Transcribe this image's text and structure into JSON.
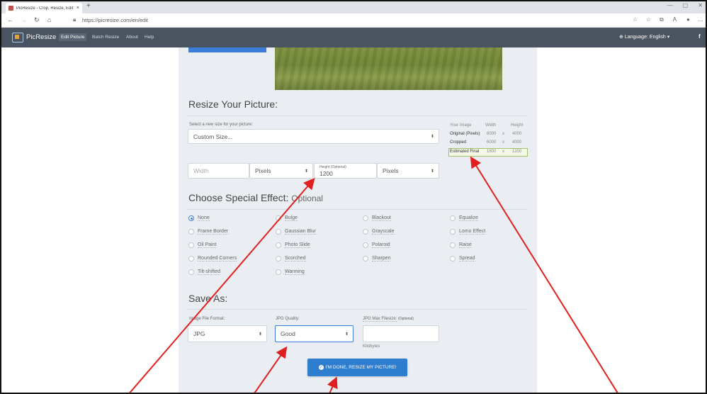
{
  "browser": {
    "tab_title": "PicResize - Crop, Resize, Edit ima",
    "tab_close": "×",
    "new_tab": "+",
    "url": "https://picresize.com/en/edit",
    "window_controls": [
      "—",
      "▢",
      "✕"
    ]
  },
  "sitenav": {
    "brand": "PicResize",
    "links": [
      "Edit Picture",
      "Batch Resize",
      "About",
      "Help"
    ],
    "language": "Language: English",
    "facebook": "f"
  },
  "resize": {
    "title": "Resize Your Picture:",
    "select_label": "Select a new size for your picture:",
    "select_value": "Custom Size...",
    "width_placeholder": "Width",
    "width_unit": "Pixels",
    "height_label": "Height (Optional)",
    "height_value": "1200",
    "height_unit": "Pixels",
    "table": {
      "headers": [
        "Your Image",
        "Width",
        "Height"
      ],
      "rows": [
        {
          "name": "Original (Pixels)",
          "width": "6000",
          "x": "x",
          "height": "4000"
        },
        {
          "name": "Cropped",
          "width": "6000",
          "x": "x",
          "height": "4000"
        },
        {
          "name": "Estimated Final",
          "width": "1800",
          "x": "x",
          "height": "1200"
        }
      ]
    }
  },
  "effects": {
    "title": "Choose Special Effect:",
    "optional": "Optional",
    "options": [
      "None",
      "Bulge",
      "Blackout",
      "Equalize",
      "Frame Border",
      "Gaussian Blur",
      "Grayscale",
      "Lomo Effect",
      "Oil Paint",
      "Photo Slide",
      "Polaroid",
      "Raise",
      "Rounded Corners",
      "Scorched",
      "Sharpen",
      "Spread",
      "Tilt-shifted",
      "Warming"
    ],
    "selected": "None"
  },
  "save": {
    "title": "Save As:",
    "format_label": "Image File Format:",
    "format_value": "JPG",
    "quality_label": "JPG Quality:",
    "quality_value": "Good",
    "maxsize_label": "JPG Max Filesize:",
    "maxsize_optional": "(Optional)",
    "maxsize_value": "",
    "maxsize_unit": "Kilobytes",
    "done_button": "I'M DONE, RESIZE MY PICTURE!"
  },
  "colors": {
    "nav_bg": "#4a5360",
    "panel_bg": "#eaeef2",
    "accent": "#2f7dcf",
    "arrow": "#e02020"
  }
}
